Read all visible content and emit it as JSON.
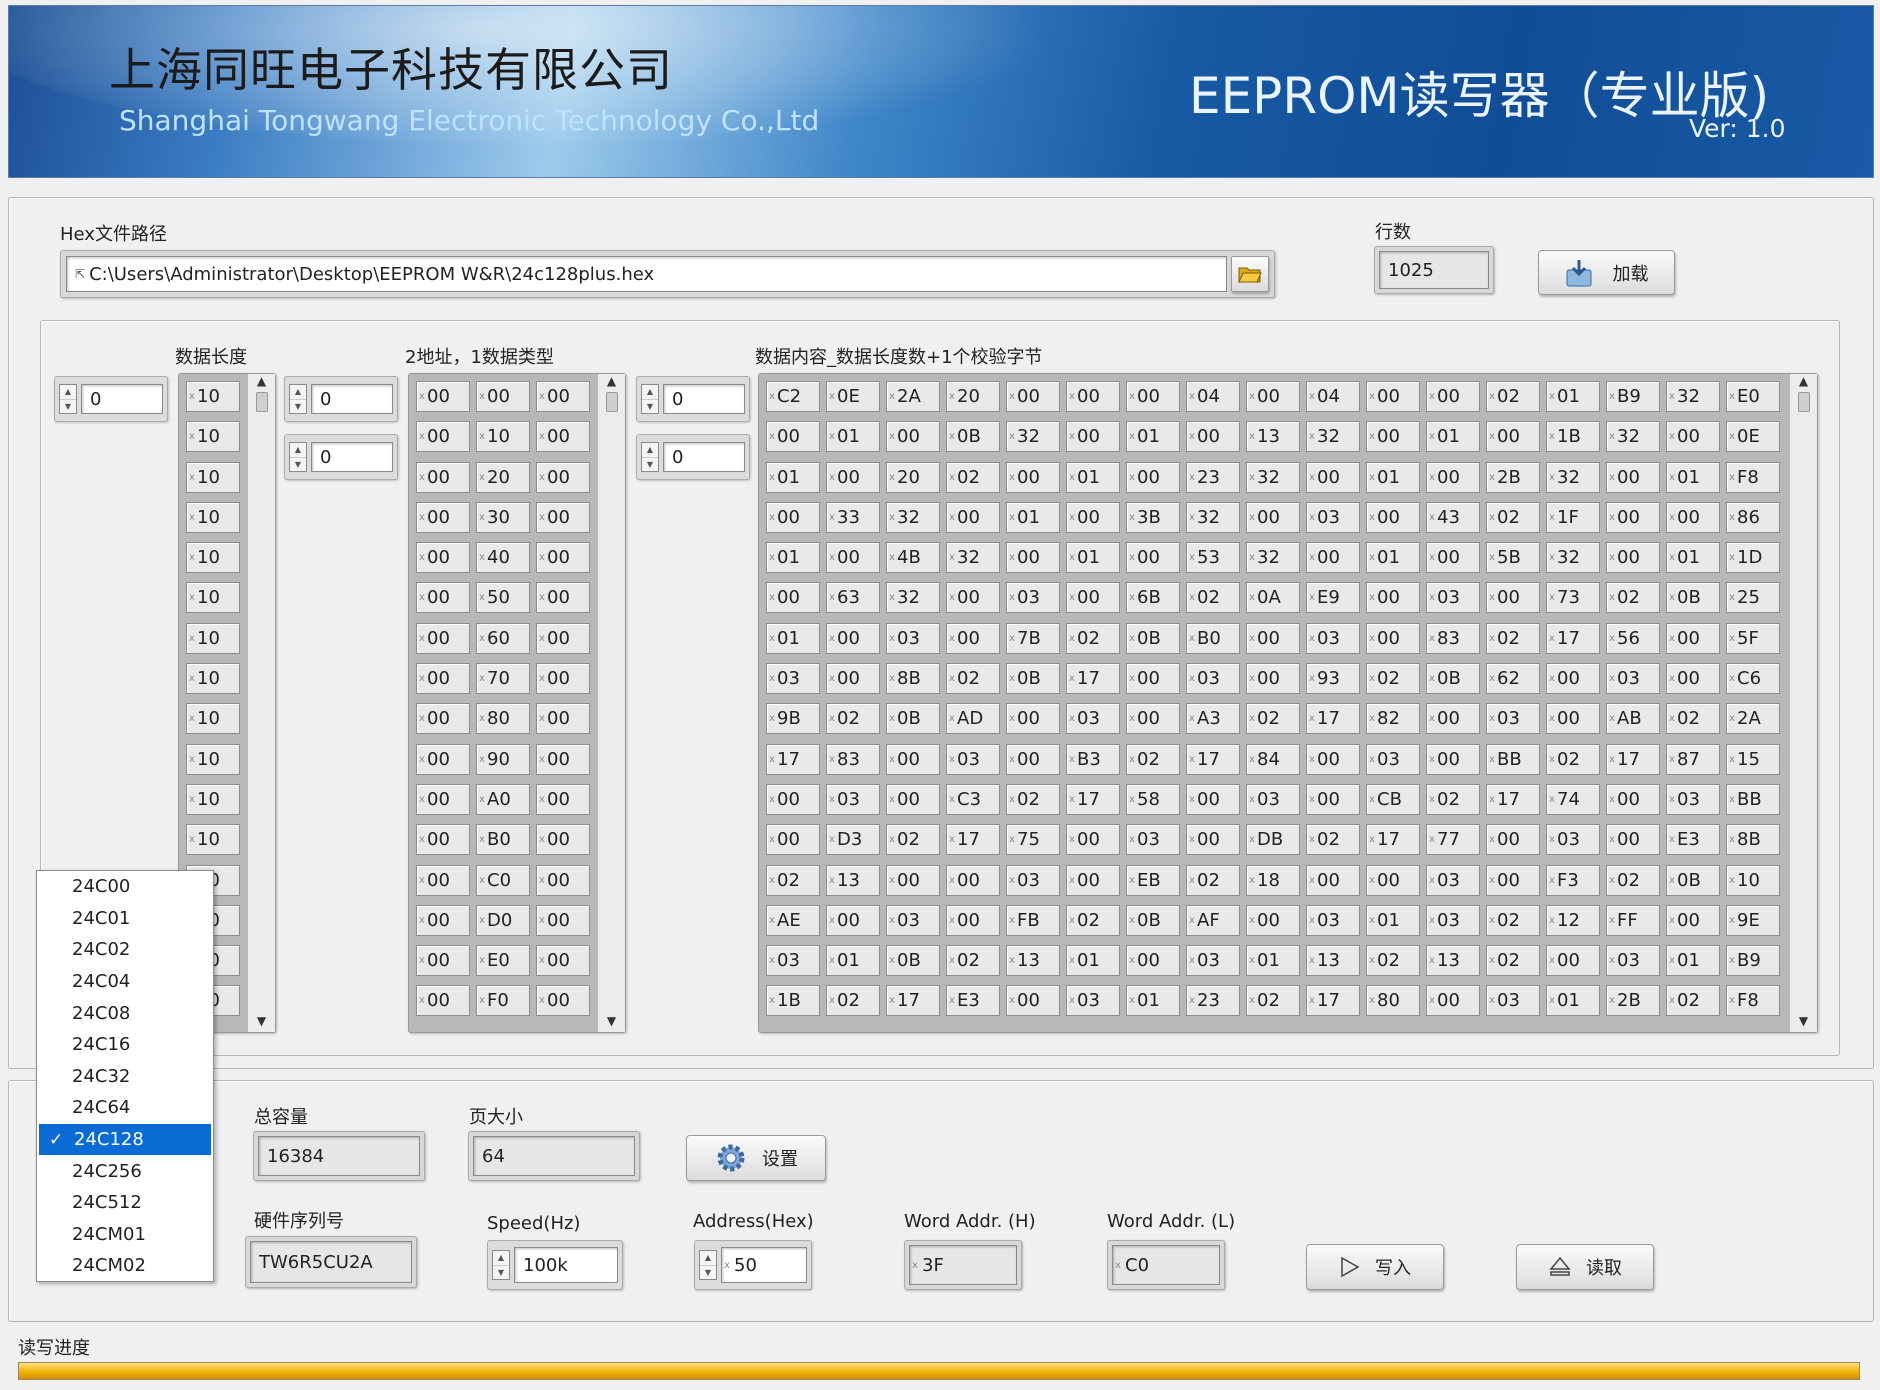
{
  "header": {
    "company_cn": "上海同旺电子科技有限公司",
    "company_en": "Shanghai Tongwang Electronic Technology Co.,Ltd",
    "product": "EEPROM读写器（专业版)",
    "version": "Ver:  1.0"
  },
  "file": {
    "path_label": "Hex文件路径",
    "path_value": "C:\\Users\\Administrator\\Desktop\\EEPROM W&R\\24c128plus.hex",
    "rows_label": "行数",
    "rows_value": "1025",
    "load_label": "加载"
  },
  "arrays": {
    "length_label": "数据长度",
    "addr_type_label": "2地址，1数据类型",
    "content_label": "数据内容_数据长度数+1个校验字节",
    "length_index": "0",
    "addr_index_row": "0",
    "addr_index_col": "0",
    "content_index_row": "0",
    "content_index_col": "0",
    "length_values": [
      "10",
      "10",
      "10",
      "10",
      "10",
      "10",
      "10",
      "10",
      "10",
      "10",
      "10",
      "10",
      "10",
      "10",
      "10",
      "10"
    ],
    "addr_rows": [
      [
        "00",
        "00",
        "00"
      ],
      [
        "00",
        "10",
        "00"
      ],
      [
        "00",
        "20",
        "00"
      ],
      [
        "00",
        "30",
        "00"
      ],
      [
        "00",
        "40",
        "00"
      ],
      [
        "00",
        "50",
        "00"
      ],
      [
        "00",
        "60",
        "00"
      ],
      [
        "00",
        "70",
        "00"
      ],
      [
        "00",
        "80",
        "00"
      ],
      [
        "00",
        "90",
        "00"
      ],
      [
        "00",
        "A0",
        "00"
      ],
      [
        "00",
        "B0",
        "00"
      ],
      [
        "00",
        "C0",
        "00"
      ],
      [
        "00",
        "D0",
        "00"
      ],
      [
        "00",
        "E0",
        "00"
      ],
      [
        "00",
        "F0",
        "00"
      ]
    ],
    "content_rows": [
      [
        "C2",
        "0E",
        "2A",
        "20",
        "00",
        "00",
        "00",
        "04",
        "00",
        "04",
        "00",
        "00",
        "02",
        "01",
        "B9",
        "32",
        "E0"
      ],
      [
        "00",
        "01",
        "00",
        "0B",
        "32",
        "00",
        "01",
        "00",
        "13",
        "32",
        "00",
        "01",
        "00",
        "1B",
        "32",
        "00",
        "0E"
      ],
      [
        "01",
        "00",
        "20",
        "02",
        "00",
        "01",
        "00",
        "23",
        "32",
        "00",
        "01",
        "00",
        "2B",
        "32",
        "00",
        "01",
        "F8"
      ],
      [
        "00",
        "33",
        "32",
        "00",
        "01",
        "00",
        "3B",
        "32",
        "00",
        "03",
        "00",
        "43",
        "02",
        "1F",
        "00",
        "00",
        "86"
      ],
      [
        "01",
        "00",
        "4B",
        "32",
        "00",
        "01",
        "00",
        "53",
        "32",
        "00",
        "01",
        "00",
        "5B",
        "32",
        "00",
        "01",
        "1D"
      ],
      [
        "00",
        "63",
        "32",
        "00",
        "03",
        "00",
        "6B",
        "02",
        "0A",
        "E9",
        "00",
        "03",
        "00",
        "73",
        "02",
        "0B",
        "25"
      ],
      [
        "01",
        "00",
        "03",
        "00",
        "7B",
        "02",
        "0B",
        "B0",
        "00",
        "03",
        "00",
        "83",
        "02",
        "17",
        "56",
        "00",
        "5F"
      ],
      [
        "03",
        "00",
        "8B",
        "02",
        "0B",
        "17",
        "00",
        "03",
        "00",
        "93",
        "02",
        "0B",
        "62",
        "00",
        "03",
        "00",
        "C6"
      ],
      [
        "9B",
        "02",
        "0B",
        "AD",
        "00",
        "03",
        "00",
        "A3",
        "02",
        "17",
        "82",
        "00",
        "03",
        "00",
        "AB",
        "02",
        "2A"
      ],
      [
        "17",
        "83",
        "00",
        "03",
        "00",
        "B3",
        "02",
        "17",
        "84",
        "00",
        "03",
        "00",
        "BB",
        "02",
        "17",
        "87",
        "15"
      ],
      [
        "00",
        "03",
        "00",
        "C3",
        "02",
        "17",
        "58",
        "00",
        "03",
        "00",
        "CB",
        "02",
        "17",
        "74",
        "00",
        "03",
        "BB"
      ],
      [
        "00",
        "D3",
        "02",
        "17",
        "75",
        "00",
        "03",
        "00",
        "DB",
        "02",
        "17",
        "77",
        "00",
        "03",
        "00",
        "E3",
        "8B"
      ],
      [
        "02",
        "13",
        "00",
        "00",
        "03",
        "00",
        "EB",
        "02",
        "18",
        "00",
        "00",
        "03",
        "00",
        "F3",
        "02",
        "0B",
        "10"
      ],
      [
        "AE",
        "00",
        "03",
        "00",
        "FB",
        "02",
        "0B",
        "AF",
        "00",
        "03",
        "01",
        "03",
        "02",
        "12",
        "FF",
        "00",
        "9E"
      ],
      [
        "03",
        "01",
        "0B",
        "02",
        "13",
        "01",
        "00",
        "03",
        "01",
        "13",
        "02",
        "13",
        "02",
        "00",
        "03",
        "01",
        "B9"
      ],
      [
        "1B",
        "02",
        "17",
        "E3",
        "00",
        "03",
        "01",
        "23",
        "02",
        "17",
        "80",
        "00",
        "03",
        "01",
        "2B",
        "02",
        "F8"
      ]
    ]
  },
  "chip_dropdown": {
    "options": [
      "24C00",
      "24C01",
      "24C02",
      "24C04",
      "24C08",
      "24C16",
      "24C32",
      "24C64",
      "24C128",
      "24C256",
      "24C512",
      "24CM01",
      "24CM02"
    ],
    "selected": "24C128",
    "check": "✓"
  },
  "settings": {
    "capacity_label": "总容量",
    "capacity_value": "16384",
    "page_label": "页大小",
    "page_value": "64",
    "setup_label": "设置",
    "serial_label": "硬件序列号",
    "serial_value": "TW6R5CU2A",
    "speed_label": "Speed(Hz)",
    "speed_value": "100k",
    "address_label": "Address(Hex)",
    "address_value": "50",
    "word_h_label": "Word Addr. (H)",
    "word_h_value": "3F",
    "word_l_label": "Word Addr. (L)",
    "word_l_value": "C0",
    "write_label": "写入",
    "read_label": "读取"
  },
  "progress": {
    "label": "读写进度",
    "value": 1.0
  },
  "colors": {
    "progress_fill": "#f1b308",
    "selection": "#0b6bd4"
  }
}
